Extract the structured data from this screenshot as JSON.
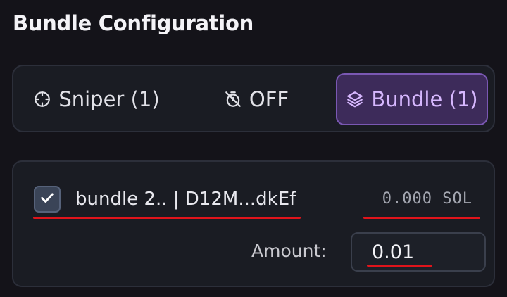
{
  "section": {
    "title": "Bundle Configuration"
  },
  "modes": [
    {
      "label": "Sniper (1)",
      "icon": "crosshair-icon",
      "selected": false
    },
    {
      "label": "OFF",
      "icon": "timer-off-icon",
      "selected": false
    },
    {
      "label": "Bundle (1)",
      "icon": "layers-icon",
      "selected": true
    }
  ],
  "bundle": {
    "checked": true,
    "label": "bundle 2.. | D12M...dkEf",
    "balance": "0.000 SOL",
    "amount_label": "Amount:",
    "amount_value": "0.01"
  },
  "colors": {
    "background": "#141319",
    "panel": "#1a1c23",
    "accent": "#7a58b3",
    "accent_text": "#d7b8ff",
    "highlight_underline": "#e0141b"
  }
}
